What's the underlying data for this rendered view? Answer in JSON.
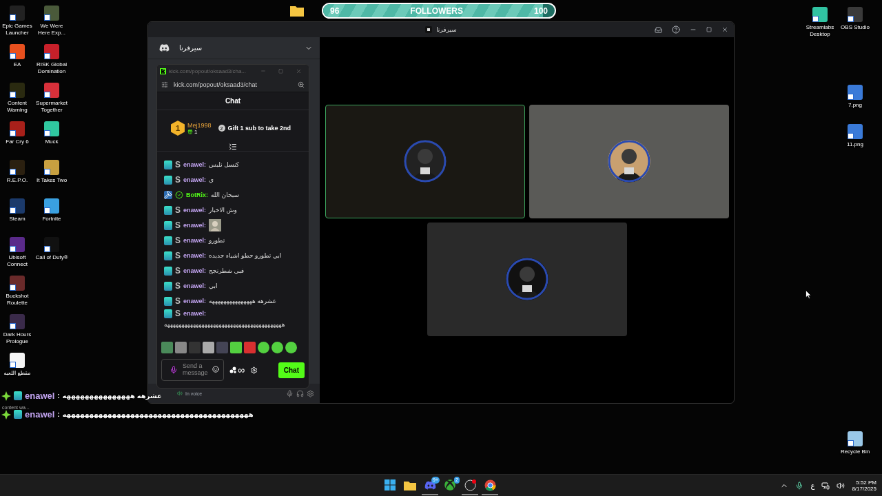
{
  "desktop_left": [
    [
      {
        "label": "Epic Games Launcher",
        "color": "#222222"
      },
      {
        "label": "EA",
        "color": "#e8501e"
      },
      {
        "label": "Content Warning",
        "color": "#2a2a10"
      },
      {
        "label": "Far Cry 6",
        "color": "#a8201a"
      },
      {
        "label": "R.E.P.O.",
        "color": "#2b2010"
      },
      {
        "label": "Steam",
        "color": "#1b3a6b"
      },
      {
        "label": "Ubisoft Connect",
        "color": "#5a2a8a"
      },
      {
        "label": "Buckshot Roulette",
        "color": "#6a2a2a"
      },
      {
        "label": "Dark Hours Prologue",
        "color": "#3a2a4a"
      },
      {
        "label": "مقطع اللعبه",
        "color": "#f4f4f4"
      }
    ],
    [
      {
        "label": "We Were Here Exp...",
        "color": "#4a5a3a"
      },
      {
        "label": "RISK Global Domination",
        "color": "#c8202a"
      },
      {
        "label": "Supermarket Together",
        "color": "#d8303a"
      },
      {
        "label": "Muck",
        "color": "#30c8a0"
      },
      {
        "label": "It Takes Two",
        "color": "#c8a040"
      },
      {
        "label": "Fortnite",
        "color": "#3aa0e0"
      },
      {
        "label": "Call of Duty®",
        "color": "#111111"
      }
    ]
  ],
  "followers_bar": {
    "start": "96",
    "label": "FOLLOWERS",
    "end": "100",
    "level": 0.95
  },
  "desktop_right": [
    {
      "label": "Streamlabs Desktop",
      "color": "#31c3a2"
    },
    {
      "label": "OBS Studio",
      "color": "#3a3a3a"
    },
    {
      "label": "7.png",
      "color": "#3a7ad8"
    },
    {
      "label": "11.png",
      "color": "#3a7ad8"
    },
    {
      "label": "Recycle Bin",
      "color": "#9ac8e8"
    }
  ],
  "discord": {
    "title": "سيرفرنا",
    "server_name": "سيرفرنا",
    "voice_status": "In voice",
    "participants": [
      {
        "speaking": true
      },
      {
        "speaking": false
      },
      {
        "speaking": false
      }
    ]
  },
  "kick_popout": {
    "tab_title": "kick.com/popout/oksaad3/cha...",
    "url": "kick.com/popout/oksaad3/chat",
    "header": "Chat",
    "leaderboard": {
      "rank": "1",
      "user": "Mej1998",
      "gifts": "1",
      "next_rank": "2",
      "prompt": "Gift 1 sub to take 2nd"
    },
    "messages": [
      {
        "kind": "subscriber",
        "badge": "S",
        "user": "enawel:",
        "text": "كنسل نلبس"
      },
      {
        "kind": "subscriber",
        "badge": "S",
        "user": "enawel:",
        "text": "ي"
      },
      {
        "kind": "bot",
        "user": "BotRix:",
        "text": "سبحان الله"
      },
      {
        "kind": "subscriber",
        "badge": "S",
        "user": "enawel:",
        "text": "وش الاخبار"
      },
      {
        "badge": "S",
        "user": "enawel:"
      },
      {
        "kind": "subscriber",
        "badge": "S",
        "user": "enawel:",
        "text": "تطورو"
      },
      {
        "kind": "subscriber",
        "badge": "S",
        "user": "enawel:",
        "text": "ابي تطورو حطو اشياء جديده"
      },
      {
        "kind": "subscriber",
        "badge": "S",
        "user": "enawel:",
        "text": "فبي شطرنجج"
      },
      {
        "kind": "subscriber",
        "badge": "S",
        "user": "enawel:",
        "text": "ابي"
      },
      {
        "kind": "subscriber",
        "badge": "S",
        "user": "enawel:",
        "text": "عشرهه هههههههههههههههه"
      },
      {
        "kind": "subscriber",
        "badge": "S",
        "user": "enawel:",
        "text": "هههههههههههههههههههههههههههههههههههههههههه"
      }
    ],
    "input": {
      "placeholder": "Send a message"
    },
    "points": "∞",
    "send": "Chat"
  },
  "overlay_chat": [
    {
      "user": "enawel",
      "separator": ":",
      "text": "عشرهه هههههههههههههههه"
    },
    {
      "user": "enawel",
      "separator": ":",
      "text": "هههههههههههههههههههههههههههههههههههههههههه"
    }
  ],
  "overlay_caption": "content wa...",
  "taskbar": {
    "apps": [
      {
        "kind": "start",
        "running": false
      },
      {
        "kind": "folder",
        "running": false
      },
      {
        "kind": "discord",
        "running": true,
        "badge": "9+"
      },
      {
        "kind": "xbox",
        "running": false,
        "badge": "2"
      },
      {
        "kind": "obs",
        "running": true
      },
      {
        "kind": "chrome",
        "running": true
      }
    ],
    "language": "ع",
    "time": "5:52 PM",
    "date": "8/17/2025"
  }
}
